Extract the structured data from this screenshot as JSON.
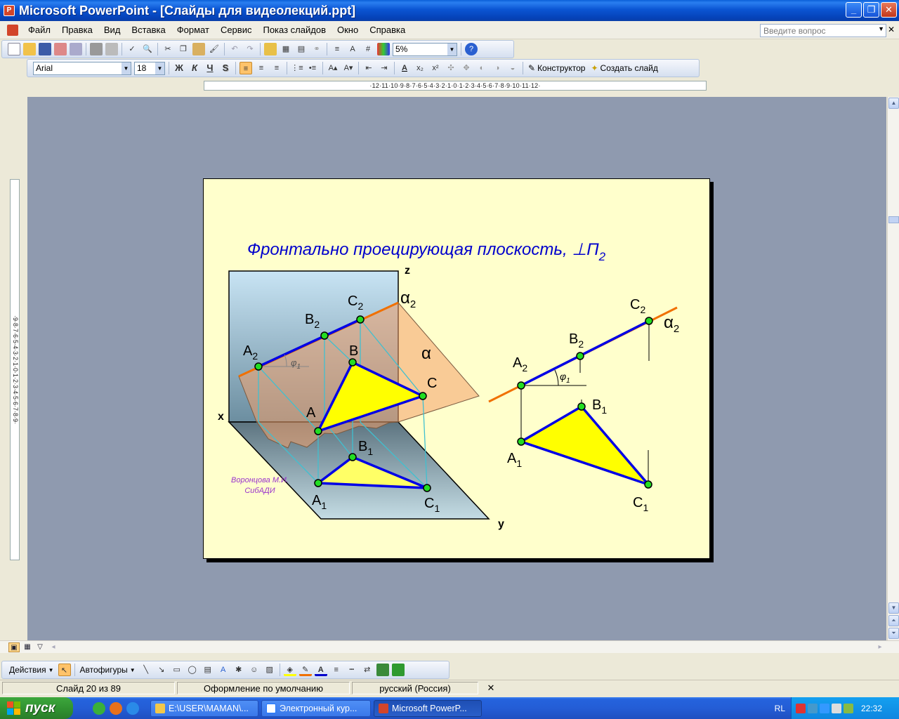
{
  "window": {
    "title": "Microsoft PowerPoint - [Слайды для видеолекций.ppt]",
    "minimize": "_",
    "maximize": "❐",
    "close": "✕"
  },
  "menu": {
    "items": [
      "Файл",
      "Правка",
      "Вид",
      "Вставка",
      "Формат",
      "Сервис",
      "Показ слайдов",
      "Окно",
      "Справка"
    ],
    "help_placeholder": "Введите вопрос",
    "doc_close": "✕"
  },
  "standard_toolbar": {
    "zoom": "5%"
  },
  "format_toolbar": {
    "font": "Arial",
    "size": "18",
    "bold": "Ж",
    "italic": "К",
    "underline": "Ч",
    "shadow": "S",
    "designer": "Конструктор",
    "new_slide": "Создать слайд"
  },
  "rulers": {
    "horizontal": "·12·11·10·9·8·7·6·5·4·3·2·1·0·1·2·3·4·5·6·7·8·9·10·11·12·",
    "vertical": "·9·8·7·6·5·4·3·2·1·0·1·2·3·4·5·6·7·8·9·"
  },
  "slide": {
    "title": "Фронтально проецирующая плоскость, ⊥П",
    "title_sub": "2",
    "author_line1": "Воронцова М.И.",
    "author_line2": "СибАДИ",
    "left_labels": {
      "z": "z",
      "x": "x",
      "y": "y",
      "alpha2": "α",
      "alpha2_sub": "2",
      "alpha": "α",
      "A2": "A",
      "A2_sub": "2",
      "B2": "B",
      "B2_sub": "2",
      "C2": "C",
      "C2_sub": "2",
      "A": "A",
      "B": "B",
      "C": "C",
      "A1": "A",
      "A1_sub": "1",
      "B1": "B",
      "B1_sub": "1",
      "C1": "C",
      "C1_sub": "1",
      "phi": "φ",
      "phi_sub": "1"
    },
    "right_labels": {
      "C2": "C",
      "C2_sub": "2",
      "alpha2": "α",
      "alpha2_sub": "2",
      "B2": "B",
      "B2_sub": "2",
      "A2": "A",
      "A2_sub": "2",
      "phi": "φ",
      "phi_sub": "1",
      "B1": "B",
      "B1_sub": "1",
      "A1": "A",
      "A1_sub": "1",
      "C1": "C",
      "C1_sub": "1"
    }
  },
  "draw_toolbar": {
    "actions": "Действия",
    "autoshapes": "Автофигуры"
  },
  "status": {
    "slide": "Слайд 20 из 89",
    "design": "Оформление по умолчанию",
    "language": "русский (Россия)"
  },
  "taskbar": {
    "start": "пуск",
    "tasks": [
      "E:\\USER\\MAMAN\\...",
      "Электронный кур...",
      "Microsoft PowerP..."
    ],
    "lang": "RL",
    "clock": "22:32"
  },
  "colors": {
    "title_blue": "#0000cc",
    "slide_bg": "#ffffcc",
    "line_blue": "#0000e6",
    "plane_orange": "#f07000",
    "point_green": "#22dd22",
    "triangle_yellow": "#ffff00",
    "author_purple": "#9933cc"
  }
}
